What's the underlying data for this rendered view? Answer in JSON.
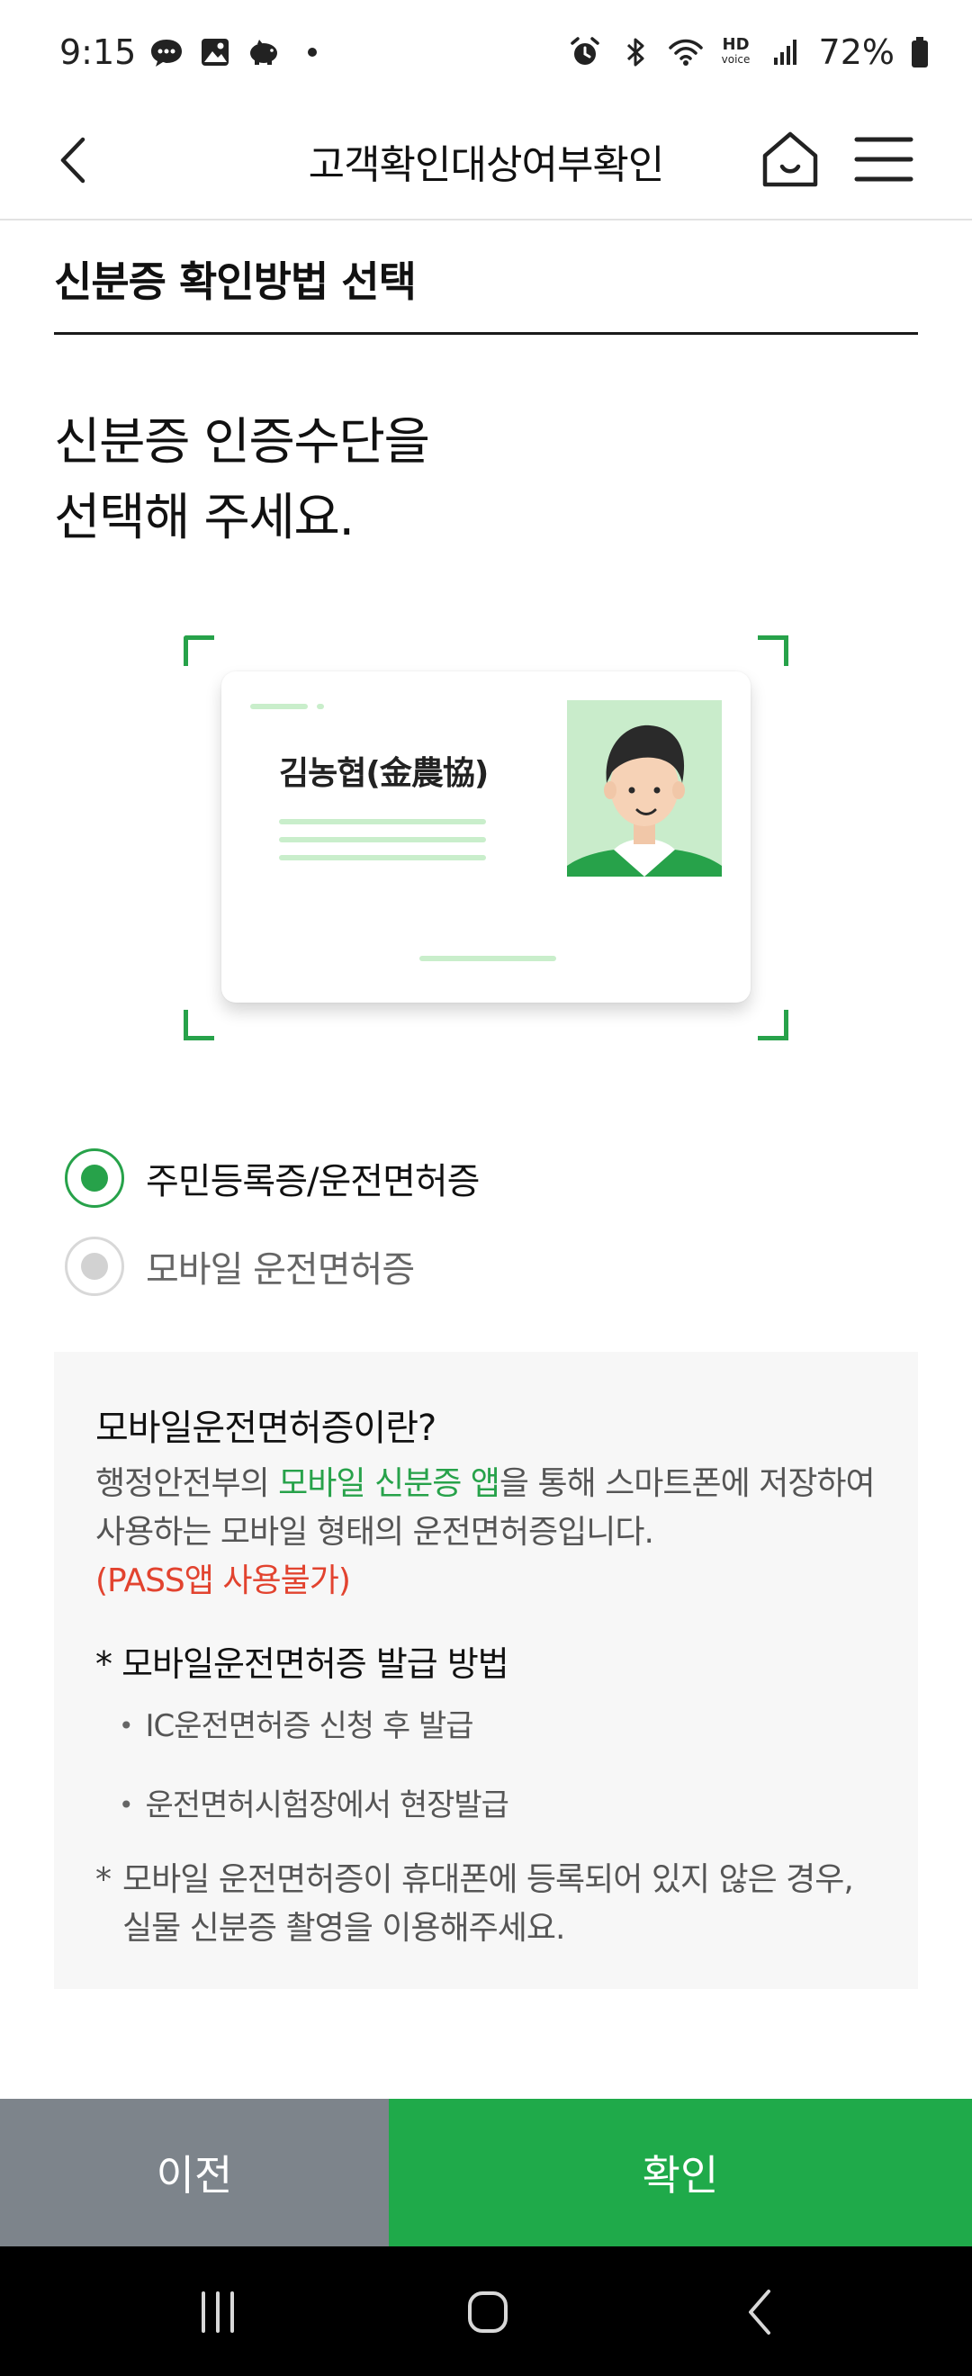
{
  "status_bar": {
    "time": "9:15",
    "battery": "72%",
    "hd_top": "HD",
    "hd_bottom": "voice",
    "icons": [
      "chat-bubble-icon",
      "image-icon",
      "piggy-bank-icon",
      "dot-icon",
      "alarm-icon",
      "bluetooth-icon",
      "wifi-icon",
      "hd-voice-icon",
      "signal-icon",
      "battery-icon"
    ]
  },
  "header": {
    "title": "고객확인대상여부확인",
    "icons": [
      "back-arrow-icon",
      "home-icon",
      "hamburger-menu-icon"
    ]
  },
  "section": {
    "title": "신분증 확인방법 선택"
  },
  "main": {
    "heading_line1": "신분증 인증수단을",
    "heading_line2": "선택해 주세요."
  },
  "id_card": {
    "name": "김농협(金農協)"
  },
  "options": [
    {
      "label": "주민등록증/운전면허증",
      "selected": true
    },
    {
      "label": "모바일 운전면허증",
      "selected": false
    }
  ],
  "info": {
    "title": "모바일운전면허증이란?",
    "desc_part1": "행정안전부의 ",
    "desc_link": "모바일 신분증 앱",
    "desc_part2": "을 통해 스마트폰에 저장하여 사용하는 모바일 형태의 운전면허증입니다.",
    "warning": "(PASS앱 사용불가)",
    "method_title": "* 모바일운전면허증 발급 방법",
    "bullets": [
      "IC운전면허증 신청 후 발급",
      "운전면허시험장에서 현장발급"
    ],
    "note_star": "*",
    "note": "모바일 운전면허증이 휴대폰에 등록되어 있지 않은 경우, 실물 신분증 촬영을 이용해주세요."
  },
  "buttons": {
    "prev": "이전",
    "confirm": "확인"
  },
  "colors": {
    "accent": "#27a24a",
    "confirm_bg": "#1faa4a",
    "prev_bg": "#7d848b",
    "warning": "#e2432f",
    "info_bg": "#f7f7f7"
  }
}
